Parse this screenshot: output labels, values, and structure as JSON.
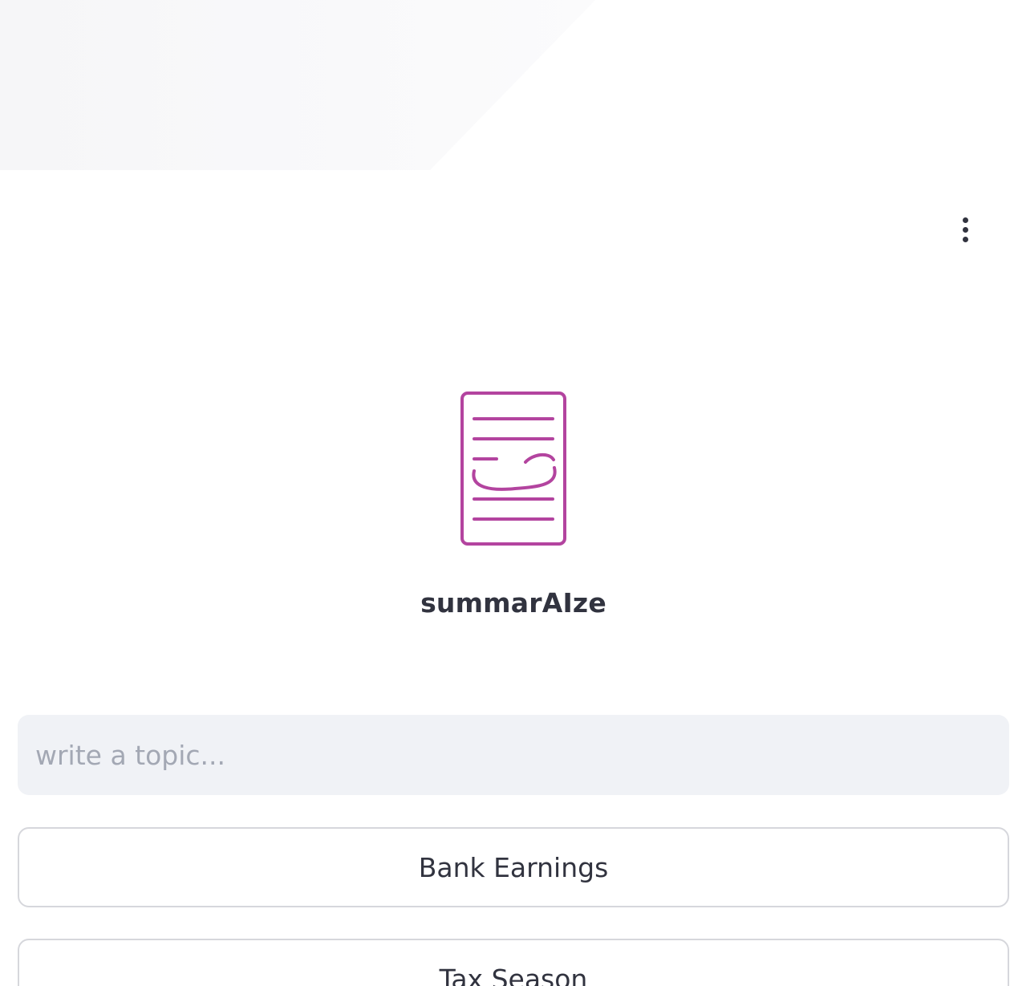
{
  "app": {
    "title": "summarAIze",
    "accent_color": "#b3449f"
  },
  "header": {
    "menu_icon": "vertical-ellipsis-icon"
  },
  "logo": {
    "icon": "smiling-document-icon"
  },
  "search": {
    "value": "",
    "placeholder": "write a topic..."
  },
  "suggestions": [
    {
      "label": "Bank Earnings"
    },
    {
      "label": "Tax Season"
    }
  ]
}
